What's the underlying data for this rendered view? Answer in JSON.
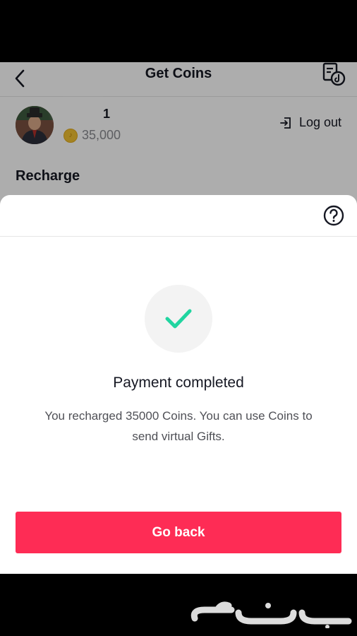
{
  "header": {
    "title": "Get Coins",
    "back_icon": "chevron-left-icon",
    "history_icon": "history-icon"
  },
  "account": {
    "username_visible_suffix": "1",
    "coin_icon": "coin-icon",
    "coin_balance": "35,000",
    "logout_label": "Log out",
    "logout_icon": "logout-icon"
  },
  "section": {
    "recharge_label": "Recharge"
  },
  "sheet": {
    "help_icon": "question-circle-icon",
    "success_icon": "checkmark-icon",
    "title": "Payment completed",
    "description": "You recharged 35000 Coins. You can use Coins to send virtual Gifts.",
    "button_label": "Go back"
  },
  "colors": {
    "accent": "#fe2c55",
    "success": "#20d5a0",
    "text": "#161823",
    "muted": "#8a8b91"
  }
}
